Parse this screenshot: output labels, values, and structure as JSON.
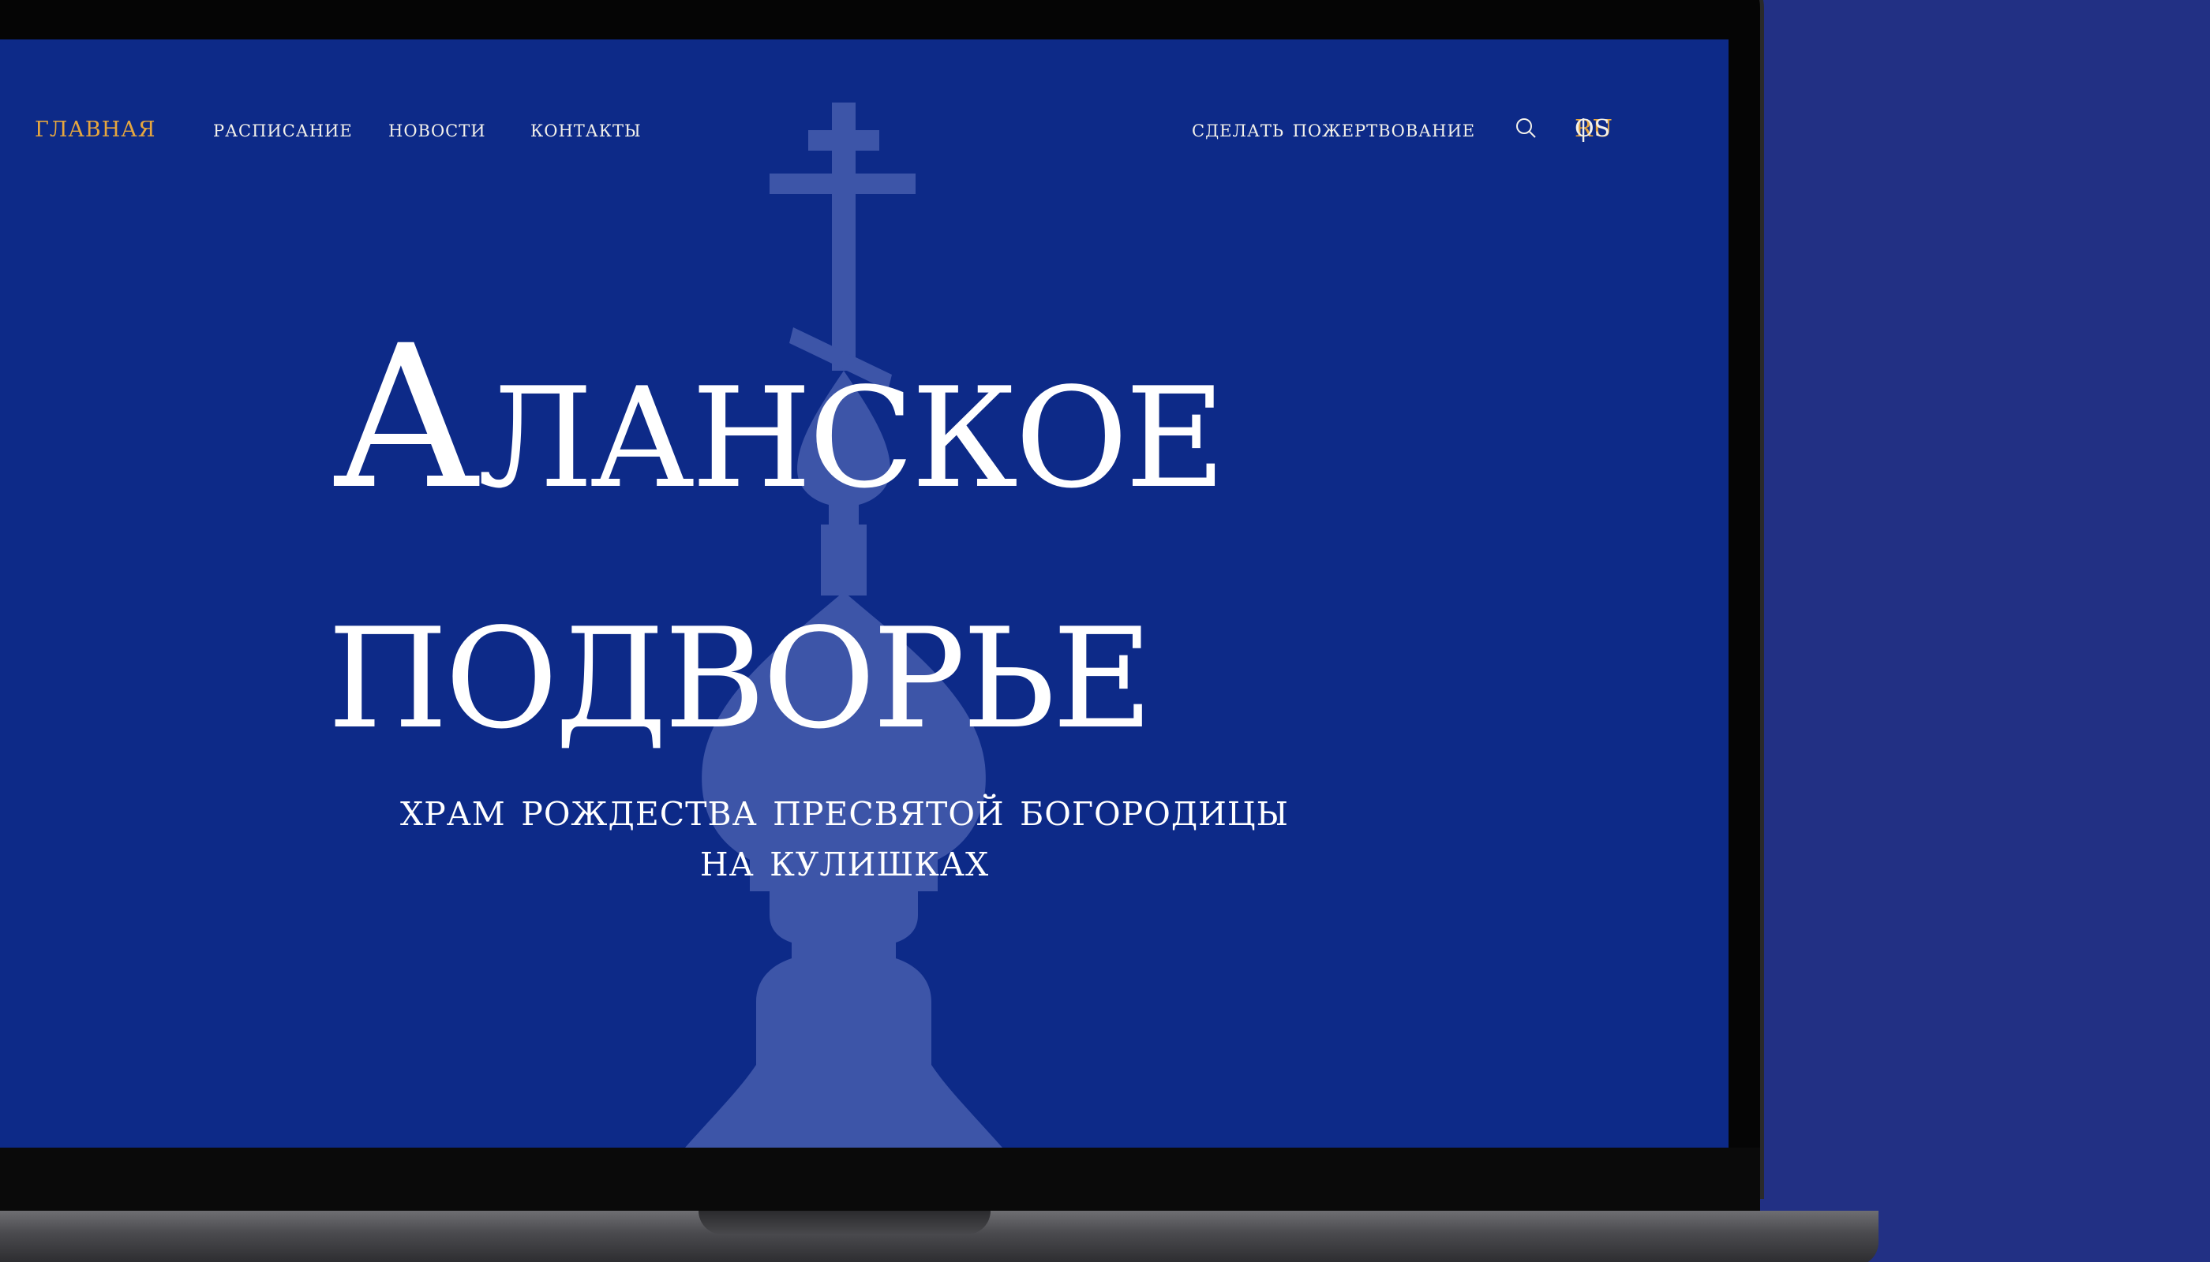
{
  "nav": {
    "home": "главная",
    "schedule": "расписание",
    "news": "новости",
    "contacts": "контакты",
    "donate": "сделать пожертвование",
    "search_icon": "search-icon",
    "lang_active": "RU",
    "lang_sep": "|",
    "lang_other": "OS"
  },
  "hero": {
    "title_line1": "Аланское",
    "title_line2": "подворье",
    "subtitle_line1": "храм рождества пресвятой богородицы",
    "subtitle_line2": "на кулишках"
  },
  "colors": {
    "background": "#223084",
    "screen": "#0d2a88",
    "accent": "#e6a63e",
    "text": "#ffffff",
    "silhouette": "#3d55a8"
  }
}
